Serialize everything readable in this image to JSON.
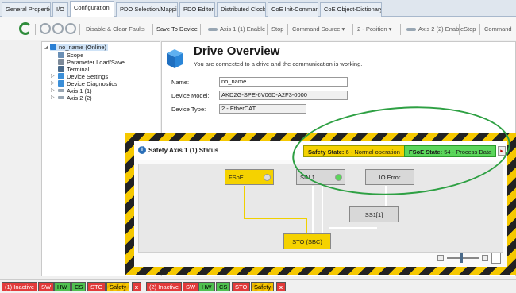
{
  "tabs": [
    {
      "label": "General Properties"
    },
    {
      "label": "I/O"
    },
    {
      "label": "Configuration"
    },
    {
      "label": "PDO Selection/Mapping"
    },
    {
      "label": "PDO Editor"
    },
    {
      "label": "Distributed Clock"
    },
    {
      "label": "CoE Init-Commands"
    },
    {
      "label": "CoE Object-Dictionary"
    }
  ],
  "toolbar": {
    "disable_clear": "Disable & Clear Faults",
    "save": "Save To Device",
    "axis1_enable": "Axis 1 (1) Enable",
    "stop1": "Stop",
    "command_source": "Command Source",
    "position": "2 - Position",
    "axis2_enable": "Axis 2 (2) Enable",
    "stop2": "Stop",
    "command_cut": "Command"
  },
  "tree": {
    "root": "no_name (Online)",
    "items": [
      "Scope",
      "Parameter Load/Save",
      "Terminal",
      "Device Settings",
      "Device Diagnostics",
      "Axis 1 (1)",
      "Axis 2 (2)"
    ]
  },
  "drive": {
    "title": "Drive Overview",
    "subtitle": "You are connected to a drive and the communication is working.",
    "name_label": "Name:",
    "name_value": "no_name",
    "model_label": "Device Model:",
    "model_value": "AKD2G-SPE-6V06D-A2F3-0000",
    "type_label": "Device Type:",
    "type_value": "2 - EtherCAT"
  },
  "safety": {
    "title": "Safety Axis 1 (1) Status",
    "state_label": "Safety State:",
    "state_value": "6 - Normal operation",
    "fsoe_label": "FSoE State:",
    "fsoe_value": "54 - Process Data",
    "nodes": {
      "fsoe": "FSoE",
      "sin": "SIN 1",
      "io_error": "IO Error",
      "ss1": "SS1[1]",
      "sto": "STO (SBC)"
    }
  },
  "status": {
    "group1_inactive": "(1) Inactive",
    "group2_inactive": "(2) Inactive",
    "sw": "SW",
    "hw": "HW",
    "cs": "CS",
    "sto": "STO",
    "safety": "Safety",
    "x": "x"
  }
}
